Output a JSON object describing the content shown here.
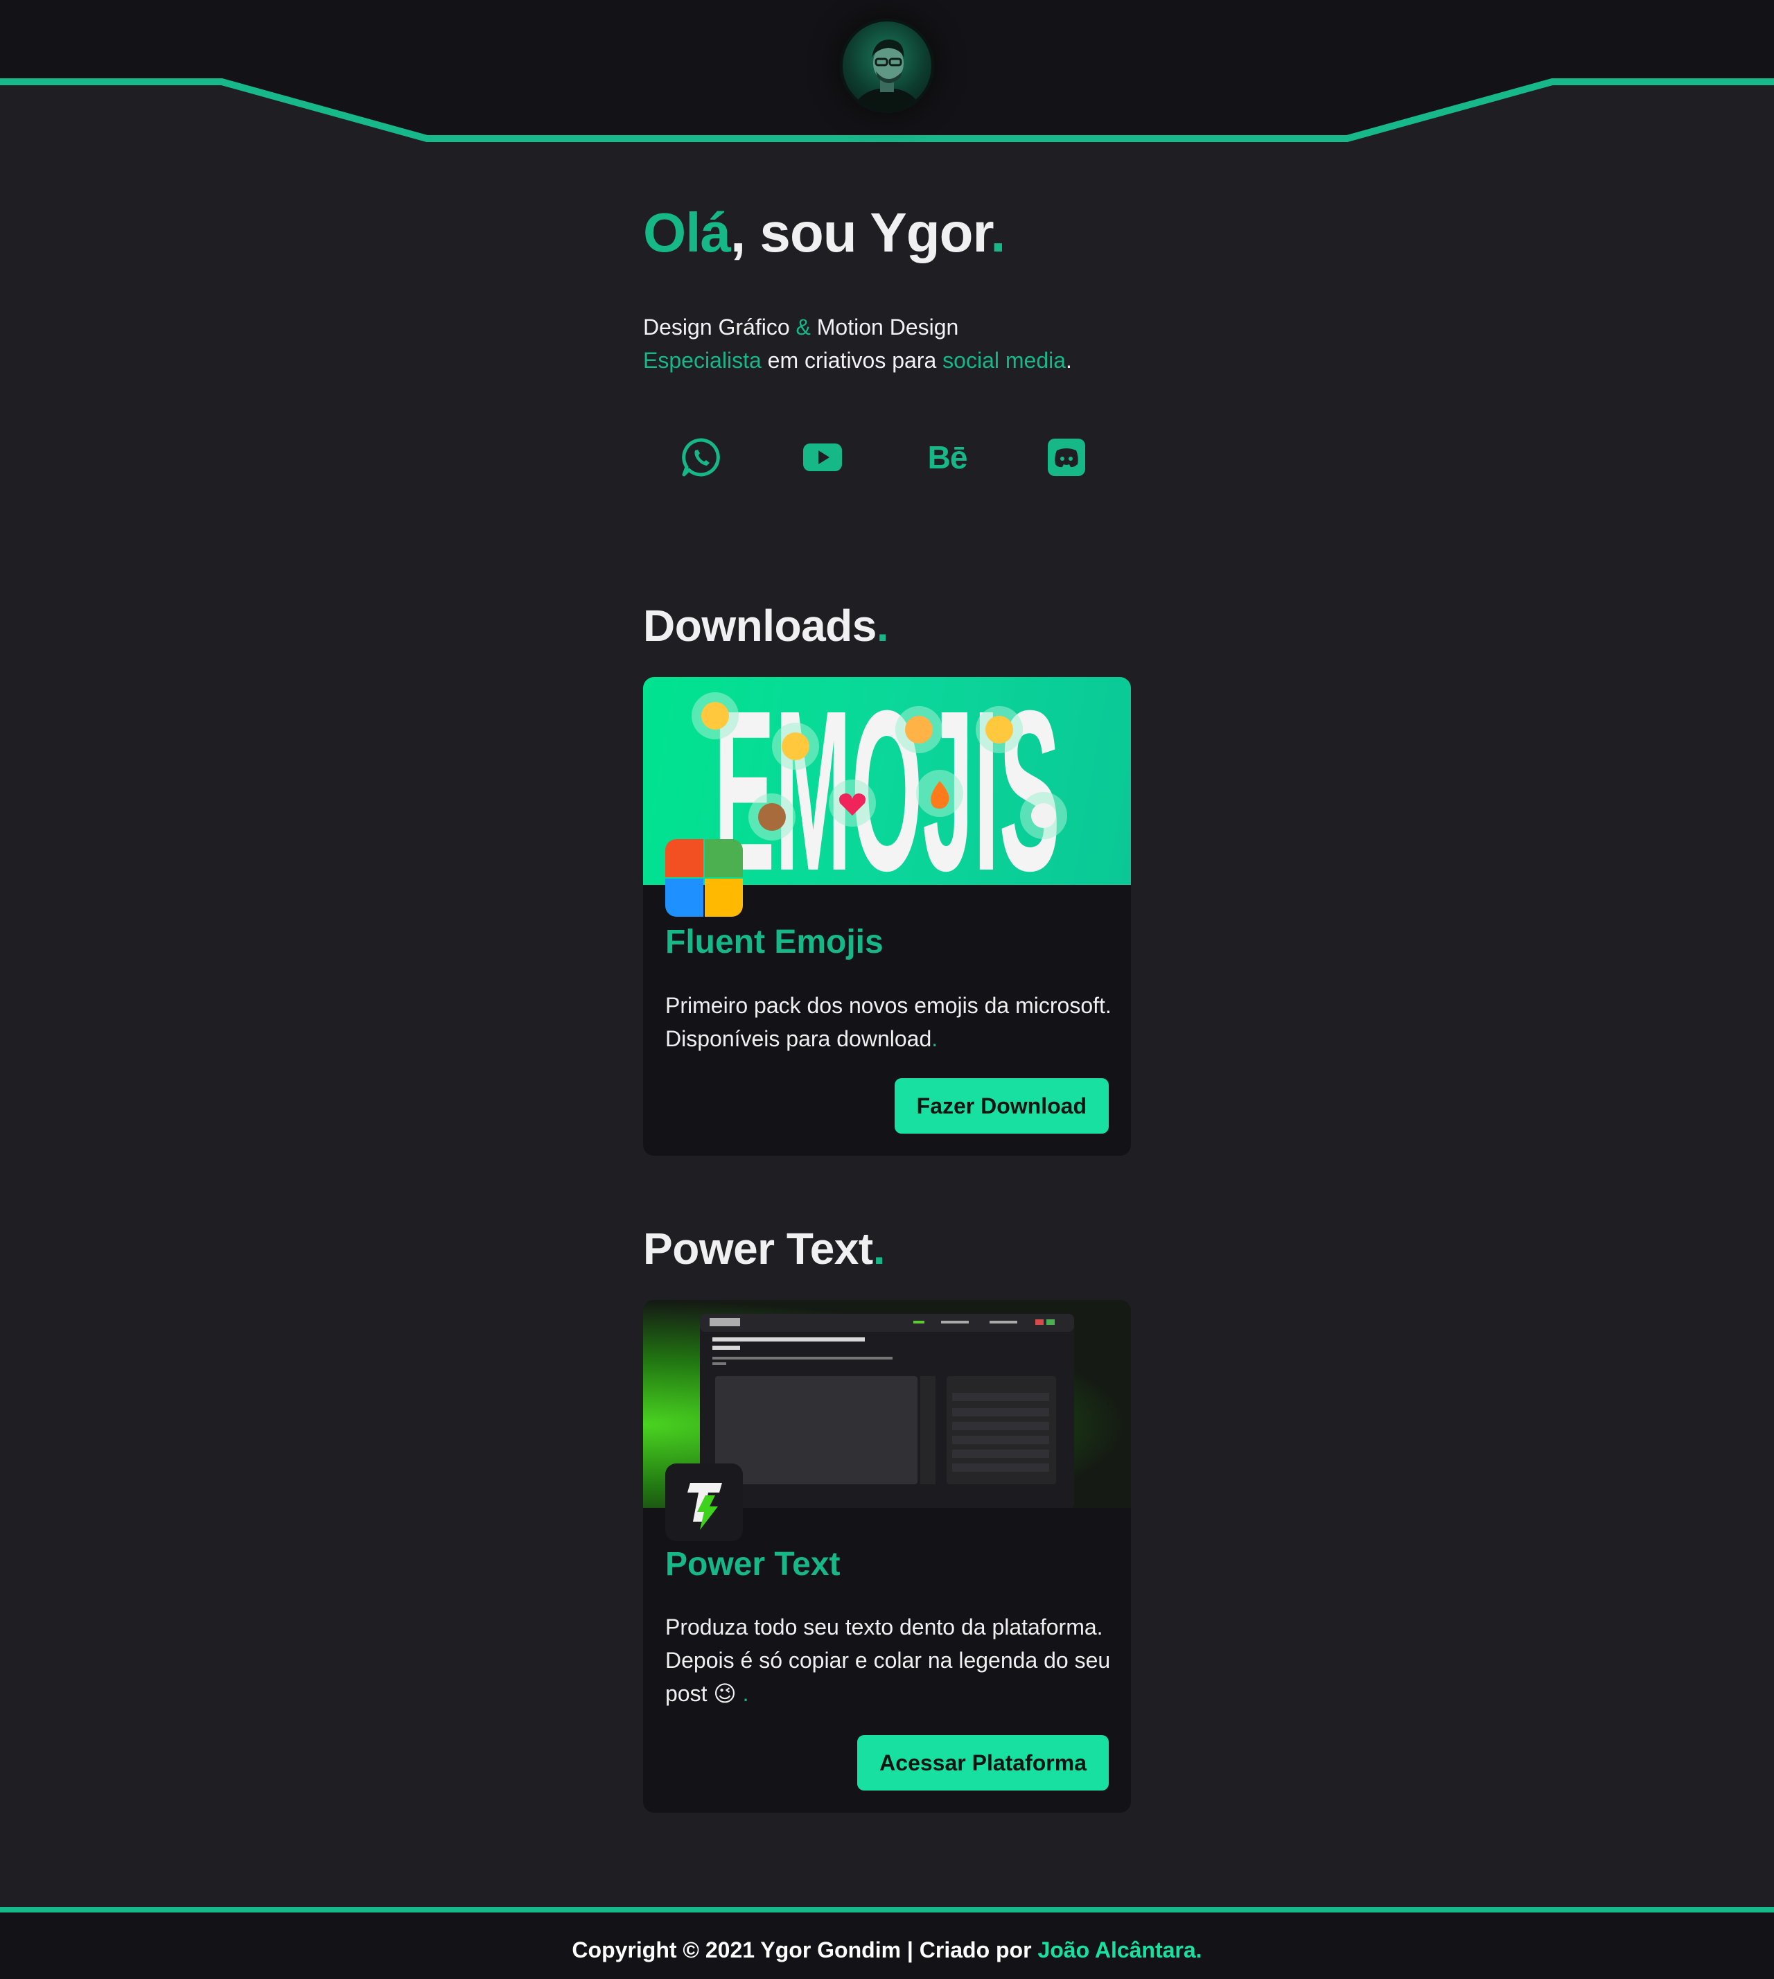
{
  "header": {
    "avatar_alt": "Ygor avatar"
  },
  "hero": {
    "greeting": "Olá",
    "rest": ", sou Ygor",
    "dot": ".",
    "line1_a": "Design Gráfico",
    "line1_amp": "&",
    "line1_b": "Motion Design",
    "line2_a": "Especialista",
    "line2_b": "em criativos para",
    "line2_c": "social media",
    "line2_dot": "."
  },
  "socials": {
    "items": [
      {
        "icon": "whatsapp-icon"
      },
      {
        "icon": "youtube-icon"
      },
      {
        "icon": "behance-icon",
        "label": "Bē"
      },
      {
        "icon": "discord-icon"
      }
    ]
  },
  "downloads": {
    "title": "Downloads",
    "dot": ".",
    "card": {
      "banner_text": "EMOJIS",
      "name": "Fluent Emojis",
      "desc": "Primeiro pack dos novos emojis da microsoft. Disponíveis para download",
      "desc_dot": ".",
      "button": "Fazer Download"
    }
  },
  "powertext": {
    "title": "Power Text",
    "dot": ".",
    "card": {
      "name": "Power Text",
      "desc": "Produza todo seu texto dento da plataforma. Depois é só copiar e colar na legenda do seu post 😉",
      "desc_dot": " .",
      "button": "Acessar Plataforma"
    }
  },
  "footer": {
    "text": "Copyright © 2021 Ygor Gondim | Criado por ",
    "link": "João Alcântara."
  },
  "colors": {
    "accent": "#15b886",
    "button": "#17e0a0",
    "background": "#1e1e23",
    "card": "#131317"
  }
}
